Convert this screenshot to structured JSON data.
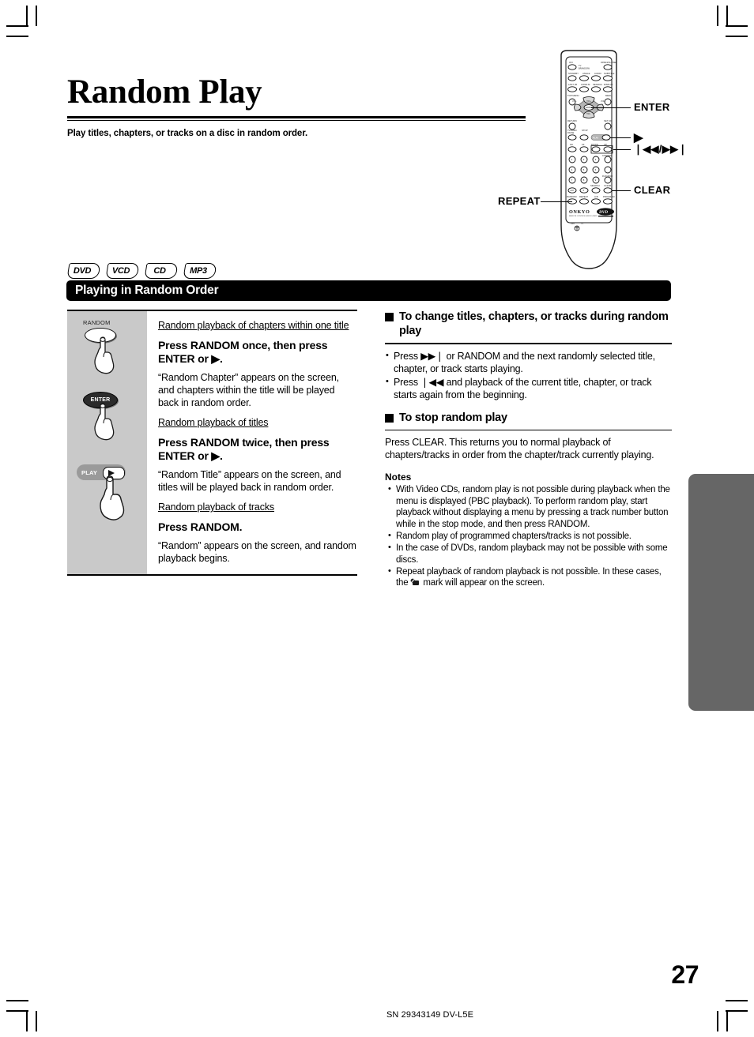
{
  "document": {
    "title": "Random Play",
    "subtitle": "Play titles, chapters, or tracks on a disc in random order.",
    "page_number": "27",
    "footer_code": "SN 29343149 DV-L5E"
  },
  "disc_badges": [
    {
      "label": "DVD"
    },
    {
      "label": "VCD"
    },
    {
      "label": "CD"
    },
    {
      "label": "MP3"
    }
  ],
  "section": {
    "banner_label": "Playing in Random Order"
  },
  "remote": {
    "brand": "ONKYO",
    "brand_sub": "REMOTE CONTROLLER RC-430DV",
    "disc_logo": "DVD",
    "callouts": [
      {
        "label": "ENTER"
      },
      {
        "label": "▶"
      },
      {
        "label": "❘◀◀/▶▶❘"
      },
      {
        "label": "CLEAR"
      },
      {
        "label": "REPEAT"
      }
    ],
    "button_rows": [
      [
        "ON",
        "TV",
        "",
        "OPEN/CLOSE"
      ],
      [
        "STANDBY",
        "ANGLE",
        "AUDIO",
        "SUBTITLE"
      ],
      [
        "LAST/IR",
        "COND.M",
        "SEARCH",
        "DISPLAY"
      ],
      [
        "TOP MENU",
        "",
        "",
        "MENU"
      ]
    ],
    "bottom_row": [
      "RANDOM",
      "REPEAT",
      "A.B.",
      "PROGRAM"
    ],
    "transport_row": [
      "FR",
      "FF",
      "DOWN",
      "UP"
    ],
    "numeric_keys": [
      "1",
      "2",
      "3",
      "4",
      "5",
      "6",
      "7",
      "8",
      "9",
      "+10",
      "0"
    ]
  },
  "procedure": {
    "buttons": [
      {
        "caption": "RANDOM",
        "kind": "oval-light",
        "label": ""
      },
      {
        "caption": "",
        "kind": "oval-dark",
        "label": "ENTER"
      },
      {
        "caption": "",
        "kind": "play-pill",
        "label": "PLAY"
      }
    ],
    "steps": [
      {
        "heading": "Random playback of chapters within one title",
        "instruction": "Press RANDOM once, then press ENTER or ▶.",
        "body": "“Random Chapter” appears on the screen, and chapters within the title will be played back in random order."
      },
      {
        "heading": "Random playback of titles",
        "instruction": "Press RANDOM twice, then press ENTER or ▶.",
        "body": "“Random Title” appears on the screen, and titles will be played back in random order."
      },
      {
        "heading": "Random playback of tracks",
        "instruction": "Press RANDOM.",
        "body": "“Random” appears on the screen, and random playback begins."
      }
    ]
  },
  "right_column": {
    "section1": {
      "heading": "To change titles, chapters, or tracks during random play",
      "bullets": [
        "Press ▶▶❘ or RANDOM and the next randomly selected title, chapter, or track starts playing.",
        "Press ❘◀◀ and playback of the current title, chapter, or track starts again from the beginning."
      ]
    },
    "section2": {
      "heading": "To stop random play",
      "paragraph": "Press CLEAR. This returns you to normal playback of chapters/tracks in order from the chapter/track currently playing."
    },
    "notes": {
      "title": "Notes",
      "items": [
        "With Video CDs, random play is not possible during playback when the menu is displayed (PBC playback). To perform random play, start playback without displaying a menu by pressing a track number button while in the stop mode, and then press RANDOM.",
        "Random play of programmed chapters/tracks is not possible.",
        "In the case of DVDs, random playback may not be possible with some discs.",
        "Repeat playback of random playback is not possible. In these cases, the  mark will appear on the screen."
      ]
    }
  },
  "colors": {
    "sidebar_gray": "#c9c9c9",
    "thumb_tab_gray": "#666666",
    "banner_black": "#000000"
  }
}
